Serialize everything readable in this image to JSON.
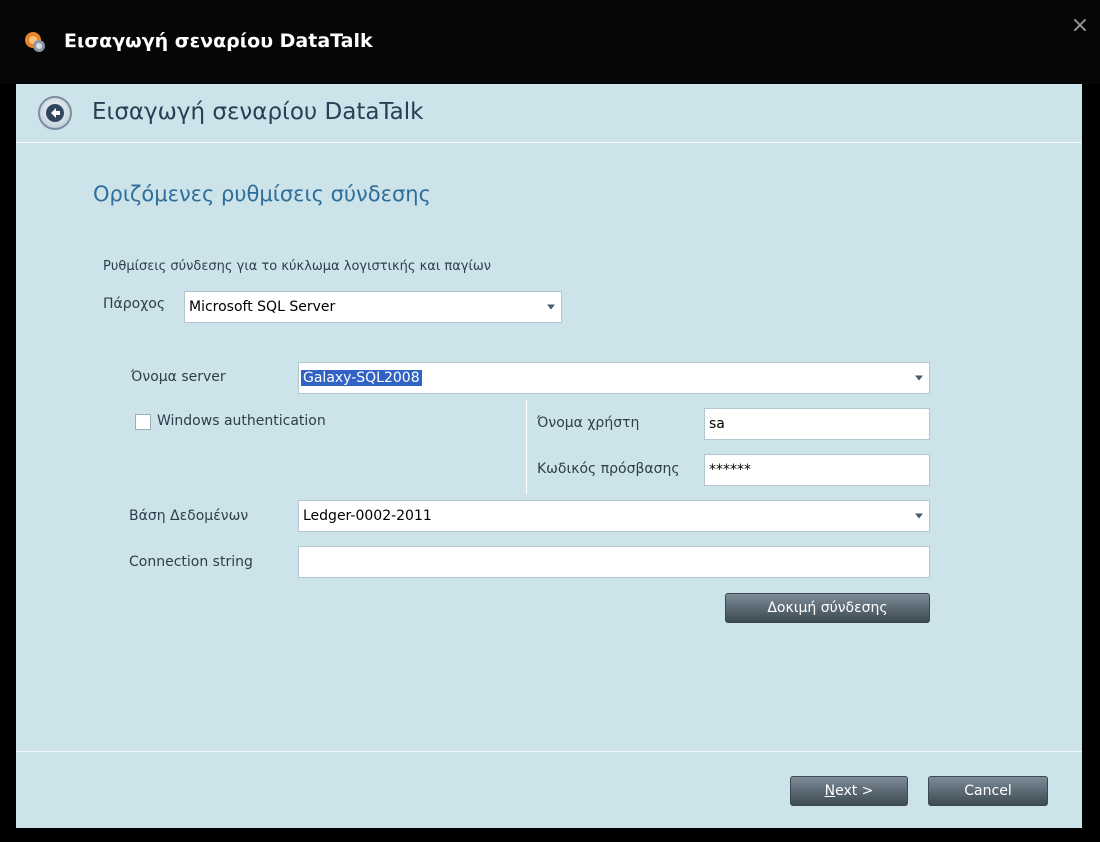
{
  "window": {
    "title": "Εισαγωγή σεναρίου DataTalk",
    "close_symbol": "×"
  },
  "header": {
    "title": "Εισαγωγή σεναρίου DataTalk",
    "back_icon": "back-arrow-icon"
  },
  "section": {
    "title": "Οριζόμενες ρυθμίσεις σύνδεσης",
    "description": "Ρυθμίσεις σύνδεσης για το κύκλωμα λογιστικής και παγίων"
  },
  "provider": {
    "label": "Πάροχος",
    "value": "Microsoft SQL Server"
  },
  "server": {
    "label": "Όνομα server",
    "value": "Galaxy-SQL2008"
  },
  "windows_auth": {
    "label": "Windows authentication",
    "checked": false
  },
  "username": {
    "label": "Όνομα χρήστη",
    "value": "sa"
  },
  "password": {
    "label": "Κωδικός πρόσβασης",
    "value": "******"
  },
  "database": {
    "label": "Βάση Δεδομένων",
    "value": "Ledger-0002-2011"
  },
  "connection_string": {
    "label": "Connection string",
    "value": ""
  },
  "buttons": {
    "test": "Δοκιμή σύνδεσης",
    "next_mnemonic": "N",
    "next_rest": "ext >",
    "cancel": "Cancel"
  },
  "colors": {
    "background": "#cde3ea",
    "titlebar": "#060606",
    "header_text": "#2a3e55",
    "section_title": "#2e6e9a",
    "selection": "#3163c5"
  }
}
